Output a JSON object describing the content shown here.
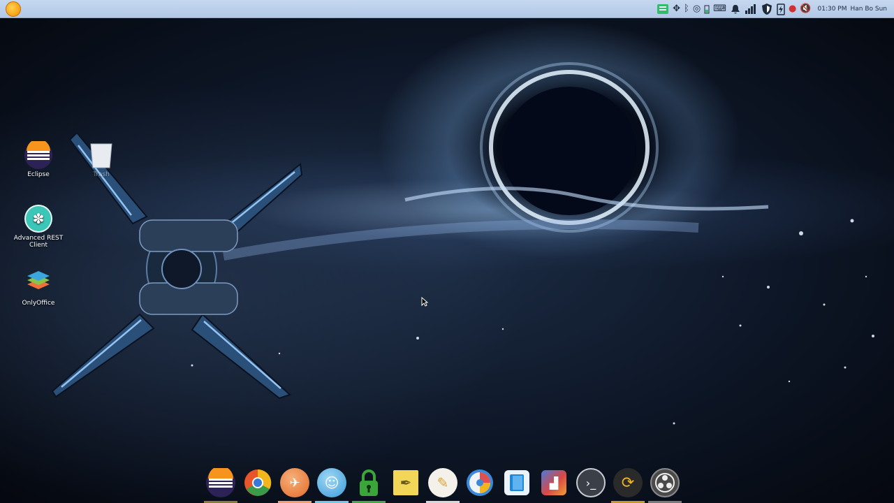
{
  "top_panel": {
    "tray_icons": [
      "green-monitor-icon",
      "dropbox-icon",
      "bluetooth-icon",
      "target-icon",
      "battery-icon",
      "keyboard-icon",
      "bell-icon",
      "signal-bars-icon",
      "shield-icon",
      "battery-charging-icon",
      "microphone-icon",
      "volume-muted-icon"
    ],
    "clock": "01:30 PM",
    "user": "Han Bo Sun"
  },
  "desktop": {
    "icons": [
      {
        "label": "Eclipse",
        "name": "eclipse-icon",
        "color": "#2c2255"
      },
      {
        "label": "Trash",
        "name": "trash-icon",
        "color": "#dfe4ea"
      },
      {
        "label": "Advanced REST Client",
        "name": "advanced-rest-client-icon",
        "color": "#3cc6b8"
      },
      {
        "label": "OnlyOffice",
        "name": "onlyoffice-icon",
        "color": "#f26f3a"
      }
    ]
  },
  "dock": {
    "items": [
      {
        "name": "eclipse",
        "color": "#2c2255",
        "indicator": "#8a7a3a"
      },
      {
        "name": "chrome",
        "color": "#e8552a",
        "indicator": ""
      },
      {
        "name": "orange-app",
        "color": "#f08a4b",
        "indicator": "#f0a070"
      },
      {
        "name": "finder",
        "color": "#58b7e8",
        "indicator": "#7ac3ea"
      },
      {
        "name": "keepassxc-lock",
        "color": "#2e9e3a",
        "indicator": "#4aa64a"
      },
      {
        "name": "notes",
        "color": "#f2d658",
        "indicator": ""
      },
      {
        "name": "feather-editor",
        "color": "#f4f1ea",
        "indicator": "#d8d8d8"
      },
      {
        "name": "disk-usage",
        "color": "#3a8ad8",
        "indicator": ""
      },
      {
        "name": "book-reader",
        "color": "#eaf3fb",
        "indicator": ""
      },
      {
        "name": "photo-tool",
        "color": "#d84848",
        "indicator": ""
      },
      {
        "name": "terminal",
        "color": "#3a3f48",
        "indicator": ""
      },
      {
        "name": "sync-app",
        "color": "#2a2a2a",
        "indicator": "#c29a2a"
      },
      {
        "name": "obs-studio",
        "color": "#4a4a4a",
        "indicator": "#7a7a7a"
      }
    ]
  }
}
